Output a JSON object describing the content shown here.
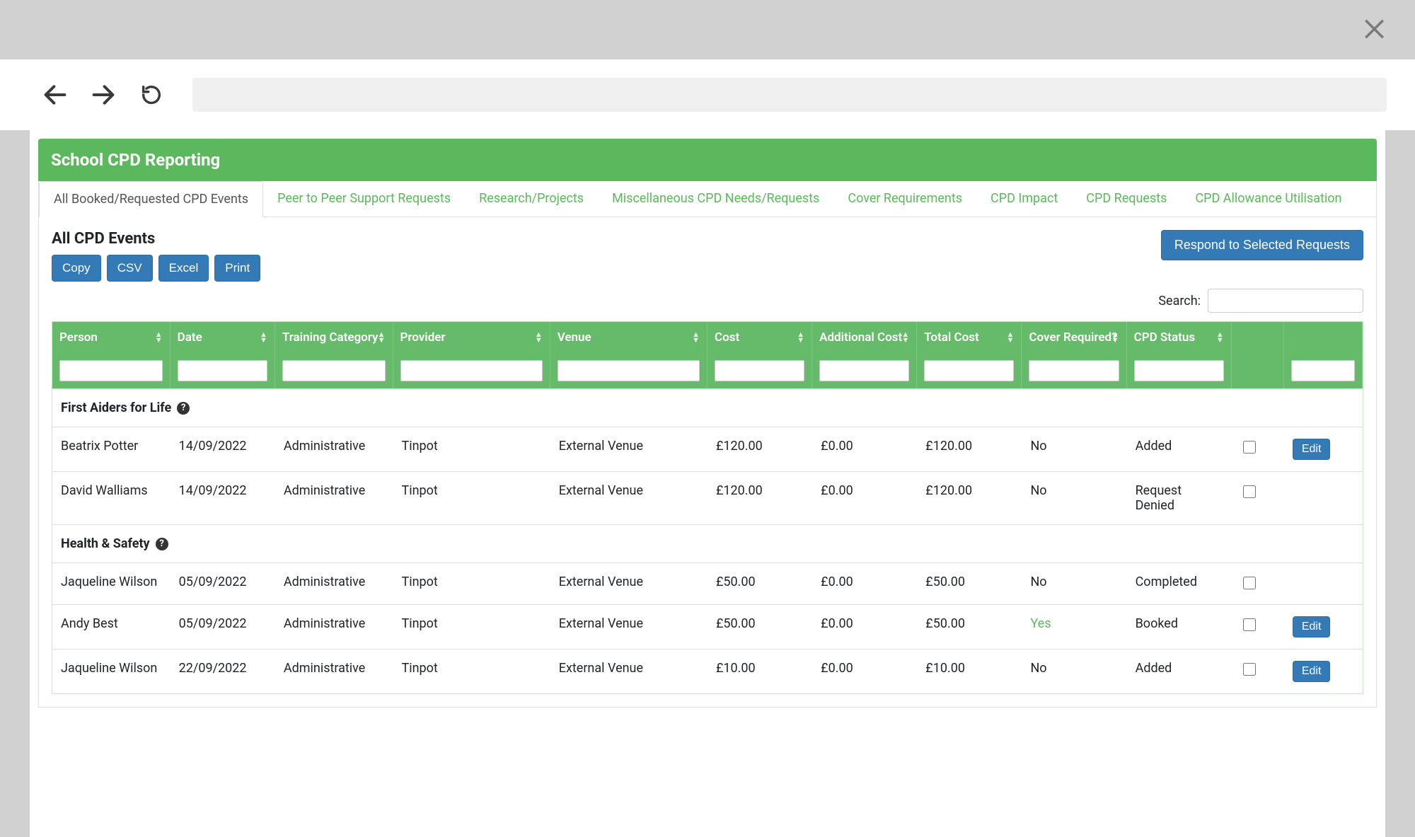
{
  "panel_title": "School CPD Reporting",
  "tabs": [
    {
      "id": "all",
      "label": "All Booked/Requested CPD Events",
      "active": true
    },
    {
      "id": "peer",
      "label": "Peer to Peer Support Requests"
    },
    {
      "id": "research",
      "label": "Research/Projects"
    },
    {
      "id": "misc",
      "label": "Miscellaneous CPD Needs/Requests"
    },
    {
      "id": "cover",
      "label": "Cover Requirements"
    },
    {
      "id": "impact",
      "label": "CPD Impact"
    },
    {
      "id": "requests",
      "label": "CPD Requests"
    },
    {
      "id": "allowance",
      "label": "CPD Allowance Utilisation"
    }
  ],
  "section_title": "All CPD Events",
  "respond_button": "Respond to Selected Requests",
  "export_buttons": [
    "Copy",
    "CSV",
    "Excel",
    "Print"
  ],
  "search_label": "Search:",
  "search_value": "",
  "columns": [
    "Person",
    "Date",
    "Training Category",
    "Provider",
    "Venue",
    "Cost",
    "Additional Cost",
    "Total Cost",
    "Cover Required?",
    "CPD Status",
    "",
    ""
  ],
  "edit_label": "Edit",
  "groups": [
    {
      "title": "First Aiders for Life",
      "rows": [
        {
          "person": "Beatrix Potter",
          "date": "14/09/2022",
          "category": "Administrative",
          "provider": "Tinpot",
          "venue": "External Venue",
          "cost": "£120.00",
          "acost": "£0.00",
          "tcost": "£120.00",
          "cover": "No",
          "status": "Added",
          "checked": false,
          "editable": true
        },
        {
          "person": "David Walliams",
          "date": "14/09/2022",
          "category": "Administrative",
          "provider": "Tinpot",
          "venue": "External Venue",
          "cost": "£120.00",
          "acost": "£0.00",
          "tcost": "£120.00",
          "cover": "No",
          "status": "Request Denied",
          "checked": false,
          "editable": false
        }
      ]
    },
    {
      "title": "Health & Safety",
      "rows": [
        {
          "person": "Jaqueline Wilson",
          "date": "05/09/2022",
          "category": "Administrative",
          "provider": "Tinpot",
          "venue": "External Venue",
          "cost": "£50.00",
          "acost": "£0.00",
          "tcost": "£50.00",
          "cover": "No",
          "status": "Completed",
          "checked": false,
          "editable": false
        },
        {
          "person": "Andy Best",
          "date": "05/09/2022",
          "category": "Administrative",
          "provider": "Tinpot",
          "venue": "External Venue",
          "cost": "£50.00",
          "acost": "£0.00",
          "tcost": "£50.00",
          "cover": "Yes",
          "status": "Booked",
          "checked": false,
          "editable": true
        },
        {
          "person": "Jaqueline Wilson",
          "date": "22/09/2022",
          "category": "Administrative",
          "provider": "Tinpot",
          "venue": "External Venue",
          "cost": "£10.00",
          "acost": "£0.00",
          "tcost": "£10.00",
          "cover": "No",
          "status": "Added",
          "checked": false,
          "editable": true
        }
      ]
    }
  ]
}
